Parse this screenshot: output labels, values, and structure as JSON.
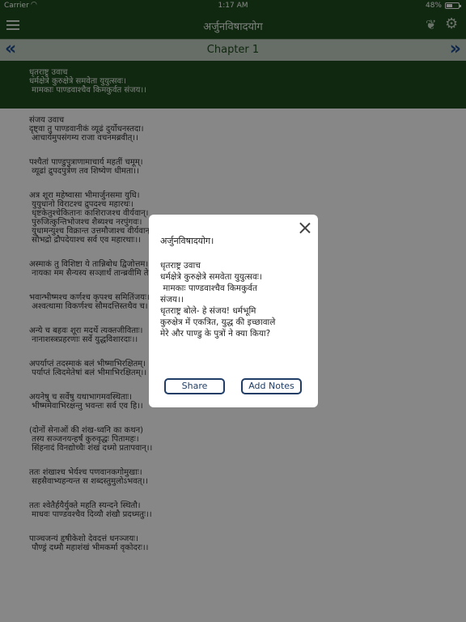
{
  "status": {
    "carrier": "Carrier",
    "time": "1:17 AM",
    "battery_percent": "48%",
    "battery_level": 0.48
  },
  "nav": {
    "title": "अर्जुनविषादयोग",
    "menu_icon": "hamburger-menu-icon",
    "right_icons": [
      "book-icon",
      "gear-icon"
    ]
  },
  "chapter": {
    "label": "Chapter 1"
  },
  "verses": [
    {
      "lines": [
        "धृतराष्ट्र उवाच",
        "धर्मक्षेत्रे कुरुक्षेत्रे समवेता युयुत्सवः।",
        " मामकाः पाण्डवाश्चैव किमकुर्वत संजय।।"
      ]
    },
    {
      "lines": [
        "संजय उवाच",
        "दृष्ट्वा तु पाण्डवानीकं व्यूढं दुर्योधनस्तदा।",
        " आचार्यमुपसंगम्य राजा वचनमब्रवीत्।।"
      ]
    },
    {
      "lines": [
        "पश्यैतां पाण्डुपुत्राणामाचार्य महतीं चमूम्।",
        " व्यूढां द्रुपदपुत्रेण तव शिष्येण धीमता।।"
      ]
    },
    {
      "lines": [
        "अत्र शूरा महेष्वासा भीमार्जुनसमा युधि।",
        " युयुधानो विराटश्च द्रुपदश्च महारथः।",
        " धृष्टकेतुश्चेकितानः काशिराजश्च वीर्यवान्।",
        " पुरुजित्कुन्तिभोजश्च शैब्यश्च नरपुंगवः।",
        " युधामन्युश्च विक्रान्त उत्तमौजाश्च वीर्यवान्।",
        " सौभद्रो द्रौपदेयाश्च सर्व एव महारथाः।।"
      ]
    },
    {
      "lines": [
        "अस्माकं तु विशिष्टा ये तान्निबोध द्विजोत्तम।",
        " नायका मम सैन्यस्य सञ्ज्ञार्थं तान्ब्रवीमि ते।।"
      ]
    },
    {
      "lines": [
        "भवान्भीष्मश्च कर्णश्च कृपश्च समितिंजयः।",
        " अश्वत्थामा विकर्णश्च सौमदत्तिस्तथैव च।।"
      ]
    },
    {
      "lines": [
        "अन्ये च बहवः शूरा मदर्थे त्यक्तजीविताः।",
        " नानाशस्त्रप्रहरणाः सर्वे युद्धविशारदाः।।"
      ]
    },
    {
      "lines": [
        "अपर्याप्तं तदस्माकं बलं भीष्माभिरक्षितम्।",
        " पर्याप्तं त्विदमेतेषां बलं भीमाभिरक्षितम्।।"
      ]
    },
    {
      "lines": [
        "अयनेषु च सर्वेषु यथाभागमवस्थिताः।",
        " भीष्ममेवाभिरक्षन्तु भवन्तः सर्व एव हि।।"
      ]
    },
    {
      "lines": [
        "(दोनों सेनाओं की शंख-ध्वनि का कथन)",
        " तस्य सञ्जनयन्हर्षं कुरुवृद्धः पितामहः।",
        " सिंहनादं विनद्योच्चैः शंखं दध्मो प्रतापवान्।।"
      ]
    },
    {
      "lines": [
        "ततः शंखाश्च भेर्यश्च पणवानकगोमुखाः।",
        " सहसैवाभ्यहन्यन्त स शब्दस्तुमुलोऽभवत्।।"
      ]
    },
    {
      "lines": [
        "ततः श्वेतैर्हयैर्युक्ते महति स्यन्दने स्थितौ।",
        " माधवः पाण्डवश्चैव दिव्यौ शंखौ प्रदध्मतुः।।"
      ]
    },
    {
      "lines": [
        "पाञ्चजन्यं हृषीकेशो देवदत्तं धनञ्जयः।",
        " पौण्ड्रं दध्मौ महाशंखं भीमकर्मा वृकोदरः।।"
      ]
    }
  ],
  "modal": {
    "title": "अर्जुनविषादयोग।",
    "body": "धृतराष्ट्र उवाच\nधर्मक्षेत्रे कुरुक्षेत्रे समवेता युयुत्सवः।\n मामकाः पाण्डवाश्चैव किमकुर्वत\nसंजय।।\nधृतराष्ट्र बोले- हे संजय! धर्मभूमि\nकुरुक्षेत्र में एकत्रित, युद्ध की इच्छावाले\nमेरे और पाण्डु के पुत्रों ने क्या किया?",
    "share_label": "Share",
    "add_notes_label": "Add Notes",
    "close_icon": "close-icon"
  }
}
